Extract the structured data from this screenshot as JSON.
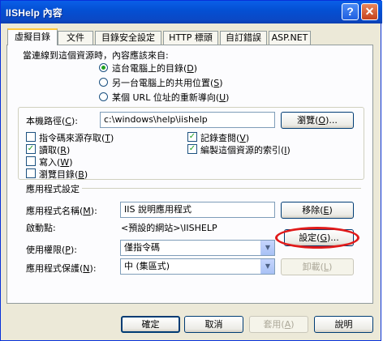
{
  "window": {
    "title": "IISHelp 內容",
    "help_glyph": "?",
    "close_glyph": "✕"
  },
  "tabs": [
    {
      "label": "虛擬目錄",
      "active": true
    },
    {
      "label": "文件"
    },
    {
      "label": "目錄安全設定"
    },
    {
      "label": "HTTP 標頭"
    },
    {
      "label": "自訂錯誤"
    },
    {
      "label": "ASP.NET"
    }
  ],
  "source": {
    "prompt": "當連線到這個資源時，內容應該來自:",
    "options": [
      {
        "label": "這台電腦上的目錄(",
        "key": "D",
        "end": ")",
        "selected": true
      },
      {
        "label": "另一台電腦上的共用位置(",
        "key": "S",
        "end": ")",
        "selected": false
      },
      {
        "label": "某個 URL 位址的重新導向(",
        "key": "U",
        "end": ")",
        "selected": false
      }
    ]
  },
  "local_path": {
    "label": "本機路徑(",
    "key": "C",
    "end": "):",
    "value": "c:\\windows\\help\\iishelp",
    "browse_label": "瀏覽(",
    "browse_key": "O",
    "browse_end": ")..."
  },
  "permissions": [
    {
      "label": "指令碼來源存取(",
      "key": "T",
      "end": ")",
      "checked": false
    },
    {
      "label": "讀取(",
      "key": "R",
      "end": ")",
      "checked": true
    },
    {
      "label": "寫入(",
      "key": "W",
      "end": ")",
      "checked": false
    },
    {
      "label": "瀏覽目錄(",
      "key": "B",
      "end": ")",
      "checked": false
    },
    {
      "label": "記錄查閱(",
      "key": "V",
      "end": ")",
      "checked": true
    },
    {
      "label": "編製這個資源的索引(",
      "key": "I",
      "end": ")",
      "checked": true
    }
  ],
  "app_settings": {
    "header": "應用程式設定",
    "name_label": "應用程式名稱(",
    "name_key": "M",
    "name_end": "):",
    "name_value": "IIS 說明應用程式",
    "remove_label": "移除(",
    "remove_key": "E",
    "remove_end": ")",
    "start_label": "啟動點:",
    "start_value": "<預設的網站>\\IISHELP",
    "config_label": "設定(",
    "config_key": "G",
    "config_end": ")...",
    "exec_label": "使用權限(",
    "exec_key": "P",
    "exec_end": "):",
    "exec_value": "僅指令碼",
    "protect_label": "應用程式保護(",
    "protect_key": "N",
    "protect_end": "):",
    "protect_value": "中 (集區式)",
    "unload_label": "卸載(",
    "unload_key": "L",
    "unload_end": ")"
  },
  "footer": {
    "ok": "確定",
    "cancel": "取消",
    "apply_label": "套用(",
    "apply_key": "A",
    "apply_end": ")",
    "help": "說明"
  },
  "annotation_color": "#e01a1a"
}
